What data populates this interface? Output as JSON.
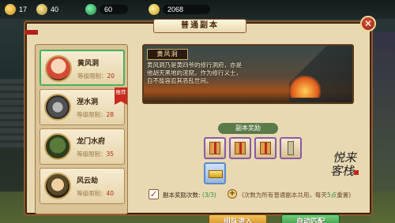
{
  "topbar": {
    "stamina": "17",
    "gold": "40",
    "jade": "60",
    "coins": "2068"
  },
  "panel": {
    "title": "普通副本",
    "close_label": "✕"
  },
  "dungeons": [
    {
      "name": "黄风洞",
      "level_label": "等级限制：",
      "level": "20",
      "selected": true,
      "tag": ""
    },
    {
      "name": "涅水洞",
      "level_label": "等级限制：",
      "level": "28",
      "selected": false,
      "tag": "推荐"
    },
    {
      "name": "龙门水府",
      "level_label": "等级限制：",
      "level": "35",
      "selected": false,
      "tag": ""
    },
    {
      "name": "风云劫",
      "level_label": "等级限制：",
      "level": "40",
      "selected": false,
      "tag": ""
    }
  ],
  "detail": {
    "scene_title": "黄风洞",
    "scene_desc": "黄风洞乃是黄四爷的修行洞府，亦是他胡天黑地的淫窟。作为修行义士，自不能容忍其恶乱世间。",
    "reward_label": "副本奖励",
    "calligraphy_line1": "悦来",
    "calligraphy_line2": "客栈",
    "reward_count_label": "副本奖励次数:",
    "reward_count": "(3/3)",
    "reward_note_prefix": "(次数为所有普通副本共用，每天",
    "reward_note_time": "5点",
    "reward_note_suffix": "重置)",
    "checkbox_mark": "✓",
    "plus_label": "+"
  },
  "buttons": {
    "team": "组队进入",
    "match": "自动匹配"
  }
}
